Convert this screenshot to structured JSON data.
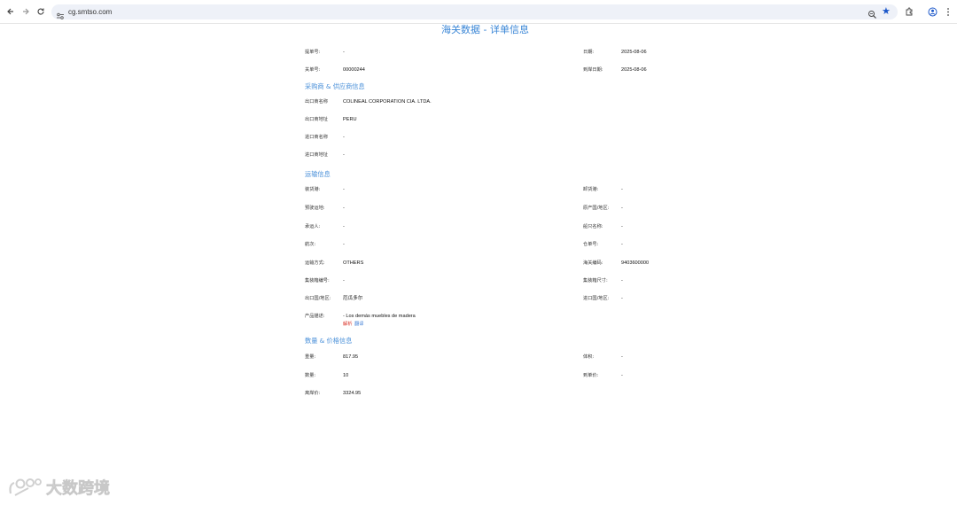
{
  "browser": {
    "url": "cg.smtso.com",
    "icons": [
      "back-arrow-icon",
      "forward-arrow-icon",
      "reload-icon",
      "site-info-icon",
      "zoom-icon",
      "bookmark-star-icon",
      "extensions-icon",
      "profile-icon",
      "menu-icon"
    ]
  },
  "page": {
    "title": "海关数据 - 详单信息"
  },
  "header_fields": {
    "bill_no_label": "提单号:",
    "bill_no_value": "-",
    "date_label": "日期:",
    "date_value": "2025-08-06",
    "customs_no_label": "关单号:",
    "customs_no_value": "00000244",
    "arrival_date_label": "到岸日期:",
    "arrival_date_value": "2025-08-06"
  },
  "sections": {
    "parties": "采购商 & 供应商信息",
    "transport": "运输信息",
    "quantity_price": "数量 & 价格信息"
  },
  "parties": {
    "exporter_name_label": "出口商名称",
    "exporter_name_value": "COLINEAL CORPORATION CIA. LTDA.",
    "exporter_addr_label": "出口商地址",
    "exporter_addr_value": "PERU",
    "importer_name_label": "进口商名称",
    "importer_name_value": "-",
    "importer_addr_label": "进口商地址",
    "importer_addr_value": "-"
  },
  "transport": {
    "loading_port_label": "装货港:",
    "loading_port_value": "-",
    "unloading_port_label": "卸货港:",
    "unloading_port_value": "-",
    "destination_label": "预驶运地:",
    "destination_value": "-",
    "origin_country_label": "原产国/地区:",
    "origin_country_value": "-",
    "carrier_label": "承运人:",
    "carrier_value": "-",
    "vessel_label": "船只名称:",
    "vessel_value": "-",
    "voyage_label": "航次:",
    "voyage_value": "-",
    "warehouse_label": "仓单号:",
    "warehouse_value": "-",
    "transport_mode_label": "运输方式:",
    "transport_mode_value": "OTHERS",
    "hs_code_label": "海关编码:",
    "hs_code_value": "9403600000",
    "container_no_label": "集装箱编号:",
    "container_no_value": "-",
    "container_size_label": "集装箱尺寸:",
    "container_size_value": "-",
    "export_country_label": "出口国/地区:",
    "export_country_value": "厄瓜多尔",
    "import_country_label": "进口国/地区:",
    "import_country_value": "-",
    "product_desc_label": "产品描述:",
    "product_desc_value": "- Los demás muebles de madera",
    "analyze_link": "解析",
    "translate_link": "翻译"
  },
  "quantity_price": {
    "weight_label": "重量:",
    "weight_value": "817.95",
    "volume_label": "体积:",
    "volume_value": "-",
    "quantity_label": "数量:",
    "quantity_value": "10",
    "unit_price_label": "到单价:",
    "unit_price_value": "-",
    "total_price_label": "离岸价:",
    "total_price_value": "3324.95"
  },
  "watermark": {
    "text": "大数跨境"
  },
  "colors": {
    "title_blue": "#3a86d6",
    "section_blue": "#4a90d9",
    "link_red": "#d93025",
    "link_blue": "#3a7bd5",
    "omnibox_bg": "#eef1f8"
  }
}
